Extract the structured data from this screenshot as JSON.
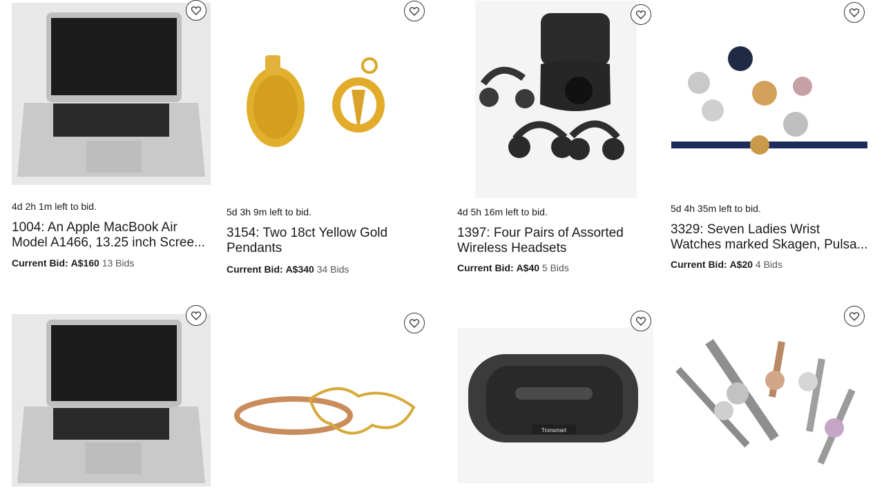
{
  "listings": [
    {
      "time_left": "4d 2h 1m left to bid.",
      "title": "1004: An Apple MacBook Air Model A1466, 13.25 inch Scree...",
      "bid_label": "Current Bid:",
      "bid_amount": "A$160",
      "bid_count": "13 Bids",
      "image": "laptop-image"
    },
    {
      "time_left": "5d 3h 9m left to bid.",
      "title": "3154: Two 18ct Yellow Gold Pendants",
      "bid_label": "Current Bid:",
      "bid_amount": "A$340",
      "bid_count": "34 Bids",
      "image": "gold-pendants-image"
    },
    {
      "time_left": "4d 5h 16m left to bid.",
      "title": "1397: Four Pairs of Assorted Wireless Headsets",
      "bid_label": "Current Bid:",
      "bid_amount": "A$40",
      "bid_count": "5 Bids",
      "image": "headsets-image"
    },
    {
      "time_left": "5d 4h 35m left to bid.",
      "title": "3329: Seven Ladies Wrist Watches marked Skagen, Pulsa...",
      "bid_label": "Current Bid:",
      "bid_amount": "A$20",
      "bid_count": "4 Bids",
      "image": "watches-image"
    },
    {
      "image": "laptop-image"
    },
    {
      "image": "bangles-image"
    },
    {
      "image": "speaker-image",
      "brand": "Tronsmart"
    },
    {
      "image": "watches-image"
    }
  ],
  "icons": {
    "favorite": "heart-icon"
  }
}
